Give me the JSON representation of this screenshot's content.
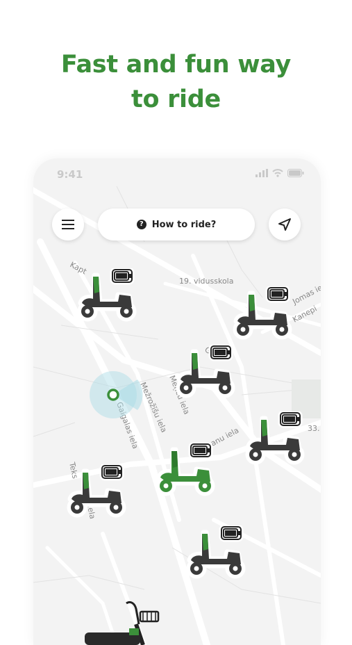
{
  "headline": {
    "line1": "Fast and fun way",
    "line2": "to ride"
  },
  "status_bar": {
    "time": "9:41"
  },
  "top_bar": {
    "how_to_label": "How to ride?",
    "help_glyph": "?"
  },
  "map": {
    "streets": [
      "Kapt",
      "19. vidusskola",
      "Jomas iela",
      "Kanepi",
      "G",
      "Meņču iela",
      "Mežrožīšu iela",
      "Gaigalas iela",
      "anu iela",
      "33.",
      "Teks",
      "iela"
    ]
  },
  "scooters": [
    {
      "label": "scooter-1",
      "battery": "high",
      "highlight": false
    },
    {
      "label": "scooter-2",
      "battery": "high",
      "highlight": false
    },
    {
      "label": "scooter-3",
      "battery": "high",
      "highlight": false
    },
    {
      "label": "scooter-4",
      "battery": "high",
      "highlight": false
    },
    {
      "label": "scooter-5",
      "battery": "high",
      "highlight": true
    },
    {
      "label": "scooter-6",
      "battery": "high",
      "highlight": false
    },
    {
      "label": "scooter-7",
      "battery": "high",
      "highlight": false
    }
  ],
  "colors": {
    "brand_green": "#3b8f3a",
    "scooter_body": "#3a3a3a",
    "map_bg": "#f3f3f3",
    "road": "#ffffff",
    "location": "#a9dbe6"
  },
  "icons": {
    "menu": "menu-icon",
    "locate": "navigation-arrow-icon",
    "help": "question-circle-icon",
    "battery": "battery-icon"
  }
}
